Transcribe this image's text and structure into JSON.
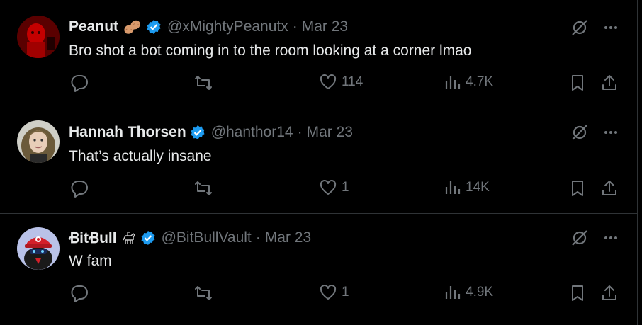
{
  "tweets": [
    {
      "name": "Peanut",
      "name_emoji": "peanut-emoji",
      "handle": "@xMightyPeanutx",
      "separator": "·",
      "date": "Mar 23",
      "text": "Bro shot a bot coming in to the room looking at a corner lmao",
      "replies": "",
      "retweets": "",
      "likes": "114",
      "views": "4.7K"
    },
    {
      "name": "Hannah Thorsen",
      "handle": "@hanthor14",
      "separator": "·",
      "date": "Mar 23",
      "text": "That’s actually insane",
      "replies": "",
      "retweets": "",
      "likes": "1",
      "views": "14K"
    },
    {
      "name": "ꞖitꞖull",
      "name_emoji": "guide-dog-emoji",
      "handle": "@BitBullVault",
      "separator": "·",
      "date": "Mar 23",
      "text": "W fam",
      "replies": "",
      "retweets": "",
      "likes": "1",
      "views": "4.9K"
    }
  ],
  "colors": {
    "background": "#000000",
    "text": "#e7e9ea",
    "secondary": "#71767b",
    "verified": "#1d9bf0",
    "divider": "#2f3336"
  },
  "icons": [
    "grok-icon",
    "more-icon",
    "reply-icon",
    "retweet-icon",
    "like-icon",
    "views-icon",
    "bookmark-icon",
    "share-icon",
    "verified-badge-icon"
  ]
}
